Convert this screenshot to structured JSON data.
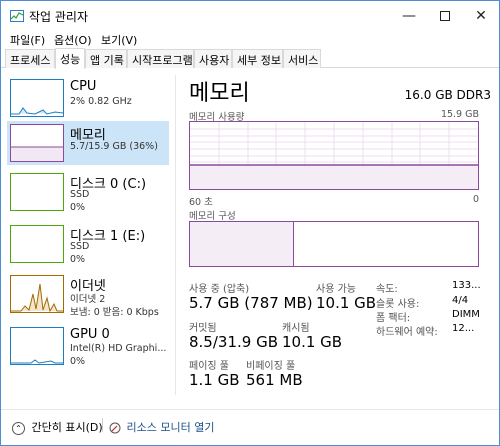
{
  "window": {
    "title": "작업 관리자"
  },
  "menu": [
    "파일(F)",
    "옵션(O)",
    "보기(V)"
  ],
  "tabs": [
    "프로세스",
    "성능",
    "앱 기록",
    "시작프로그램",
    "사용자",
    "세부 정보",
    "서비스"
  ],
  "sidebar": [
    {
      "name": "CPU",
      "sub1": "2% 0.82 GHz",
      "color": "#1c7fc1"
    },
    {
      "name": "메모리",
      "sub1": "5.7/15.9 GB (36%)",
      "color": "#8b4a9e"
    },
    {
      "name": "디스크 0 (C:)",
      "sub1": "SSD",
      "sub2": "0%",
      "color": "#4da60c"
    },
    {
      "name": "디스크 1 (E:)",
      "sub1": "SSD",
      "sub2": "0%",
      "color": "#4da60c"
    },
    {
      "name": "이더넷",
      "sub1": "이더넷 2",
      "sub2": "보냄: 0 받음: 0 Kbps",
      "color": "#a36a00"
    },
    {
      "name": "GPU 0",
      "sub1": "Intel(R) HD Graphi...",
      "sub2": "0%",
      "color": "#1c7fc1"
    }
  ],
  "main": {
    "title": "메모리",
    "spec": "16.0 GB DDR3",
    "usage_label": "메모리 사용량",
    "usage_max": "15.9 GB",
    "time_label": "60 초",
    "time_end": "0",
    "composition_label": "메모리 구성",
    "usage_fraction": 0.36,
    "stats": {
      "in_use_label": "사용 중 (압축)",
      "in_use_value": "5.7 GB (787 MB)",
      "available_label": "사용 가능",
      "available_value": "10.1 GB",
      "committed_label": "커밋됨",
      "committed_value": "8.5/31.9 GB",
      "cached_label": "캐시됨",
      "cached_value": "10.1 GB",
      "paged_label": "페이징 풀",
      "paged_value": "1.1 GB",
      "nonpaged_label": "비페이징 풀",
      "nonpaged_value": "561 MB"
    },
    "details": [
      {
        "k": "속도:",
        "v": "133..."
      },
      {
        "k": "슬롯 사용:",
        "v": "4/4"
      },
      {
        "k": "폼 팩터:",
        "v": "DIMM"
      },
      {
        "k": "하드웨어 예약:",
        "v": "12..."
      }
    ]
  },
  "bottom": {
    "fewer": "간단히 표시(D)",
    "resmon": "리소스 모니터 열기"
  }
}
